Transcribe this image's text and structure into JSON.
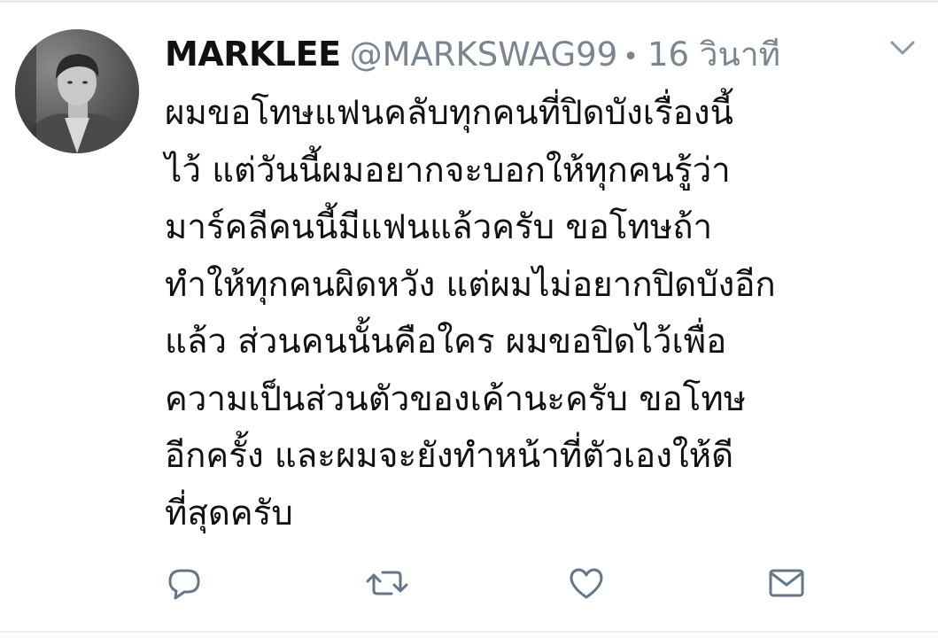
{
  "tweet": {
    "display_name": "MARKLEE",
    "handle": "@MARKSWAG99",
    "separator": "•",
    "timestamp": "16 วินาที",
    "lines": [
      "ผมขอโทษแฟนคลับทุกคนที่ปิดบังเรื่องนี้",
      "ไว้ แต่วันนี้ผมอยากจะบอกให้ทุกคนรู้ว่า",
      "มาร์คลีคนนี้มีแฟนแล้วครับ ขอโทษถ้า",
      "ทำให้ทุกคนผิดหวัง แต่ผมไม่อยากปิดบังอีก",
      "แล้ว ส่วนคนนั้นคือใคร ผมขอปิดไว้เพื่อ",
      "ความเป็นส่วนตัวของเค้านะครับ ขอโทษ",
      "อีกครั้ง และผมจะยังทำหน้าที่ตัวเองให้ดี",
      "ที่สุดครับ"
    ]
  },
  "icons": {
    "caret": "chevron-down-icon",
    "reply": "reply-icon",
    "retweet": "retweet-icon",
    "like": "heart-icon",
    "message": "envelope-icon"
  },
  "colors": {
    "text": "#111111",
    "muted": "#7a8590",
    "icon": "#657786",
    "background": "#ffffff"
  }
}
